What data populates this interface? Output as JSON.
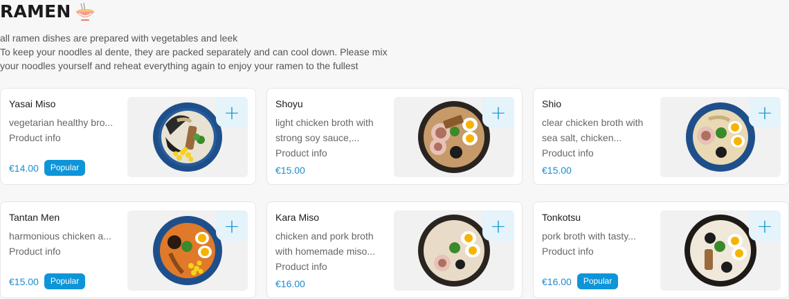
{
  "section": {
    "title": "RAMEN",
    "description_lines": [
      "all ramen dishes are prepared with vegetables and leek",
      "To keep your noodles al dente, they are packed separately and can cool down. Please mix",
      "your noodles yourself and reheat everything again to enjoy your ramen to the fullest"
    ]
  },
  "product_info_label": "Product info",
  "add_icon": "plus-icon",
  "colors": {
    "accent": "#1b8ccc",
    "badge": "#0e95d8",
    "add_bg": "#e5f3fb"
  },
  "items": [
    {
      "name": "Yasai Miso",
      "description": "vegetarian healthy bro...",
      "price": "€14.00",
      "badge": "Popular"
    },
    {
      "name": "Shoyu",
      "description": "light chicken broth with strong soy sauce,...",
      "price": "€15.00",
      "badge": ""
    },
    {
      "name": "Shio",
      "description": "clear chicken broth with sea salt, chicken...",
      "price": "€15.00",
      "badge": ""
    },
    {
      "name": "Tantan Men",
      "description": "harmonious chicken a...",
      "price": "€15.00",
      "badge": "Popular"
    },
    {
      "name": "Kara Miso",
      "description": "chicken and pork broth with homemade miso...",
      "price": "€16.00",
      "badge": ""
    },
    {
      "name": "Tonkotsu",
      "description": "pork broth with tasty...",
      "price": "€16.00",
      "badge": "Popular"
    }
  ]
}
